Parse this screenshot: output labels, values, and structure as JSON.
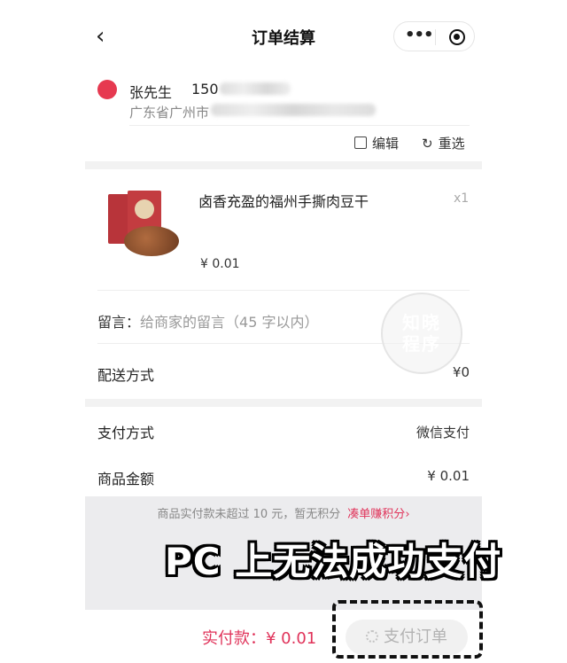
{
  "nav": {
    "title": "订单结算"
  },
  "address": {
    "name": "张先生",
    "phone_visible": "150",
    "region_visible": "广东省广州市",
    "edit_label": "编辑",
    "reselect_label": "重选"
  },
  "product": {
    "name": "卤香充盈的福州手撕肉豆干",
    "quantity": "x1",
    "price": "¥ 0.01"
  },
  "memo": {
    "label": "留言：",
    "placeholder": "给商家的留言（45 字以内）"
  },
  "rows": {
    "delivery": {
      "label": "配送方式",
      "value": "¥0"
    },
    "payment": {
      "label": "支付方式",
      "value": "微信支付"
    },
    "amount": {
      "label": "商品金额",
      "value": "¥ 0.01"
    }
  },
  "watermark": {
    "line1": "知晓",
    "line2": "程序"
  },
  "notice": {
    "text": "商品实付款未超过 10 元，暂无积分",
    "link": "凑单赚积分"
  },
  "overlay_caption": "PC 上无法成功支付",
  "paybar": {
    "total": "实付款：¥ 0.01",
    "pay_button": "支付订单"
  },
  "colors": {
    "accent": "#e0335a",
    "address_dot": "#e63950"
  }
}
